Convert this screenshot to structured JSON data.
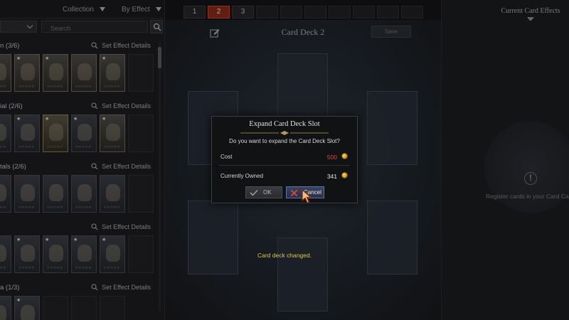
{
  "collection_panel": {
    "sort_label": "Collection",
    "filter_label": "By Effect",
    "search_placeholder": "Search",
    "sections": [
      {
        "title": "n (3/6)",
        "details_label": "Set Effect Details"
      },
      {
        "title": "ial (2/6)",
        "details_label": "Set Effect Details"
      },
      {
        "title": "tals (2/6)",
        "details_label": "Set Effect Details"
      },
      {
        "title": "",
        "details_label": "Set Effect Details"
      },
      {
        "title": "a (1/3)",
        "details_label": "Set Effect Details"
      }
    ]
  },
  "deck_tabs": [
    "1",
    "2",
    "3",
    "",
    "",
    "",
    "",
    "",
    "",
    ""
  ],
  "active_tab_index": 1,
  "deck": {
    "title": "Card Deck 2",
    "save_label": "Save",
    "status_message": "Card deck changed."
  },
  "right_panel": {
    "title": "Current Card Effects",
    "info_icon": "!",
    "empty_text": "Register cards in your Card Catalo"
  },
  "modal": {
    "title": "Expand Card Deck Slot",
    "question": "Do you want to expand the Card Deck Slot?",
    "cost_label": "Cost",
    "cost_value": "500",
    "owned_label": "Currently Owned",
    "owned_value": "341",
    "ok_label": "OK",
    "cancel_label": "Cancel"
  },
  "colors": {
    "accent_tab": "#8a2a1c",
    "cost_red": "#e0453a",
    "toast_yellow": "#dcc93a",
    "coin_gold": "#d49b1c"
  },
  "icons": [
    "search-icon",
    "magnifier-icon",
    "edit-icon",
    "info-icon",
    "coin-icon",
    "check-icon",
    "x-icon",
    "cursor-icon"
  ]
}
